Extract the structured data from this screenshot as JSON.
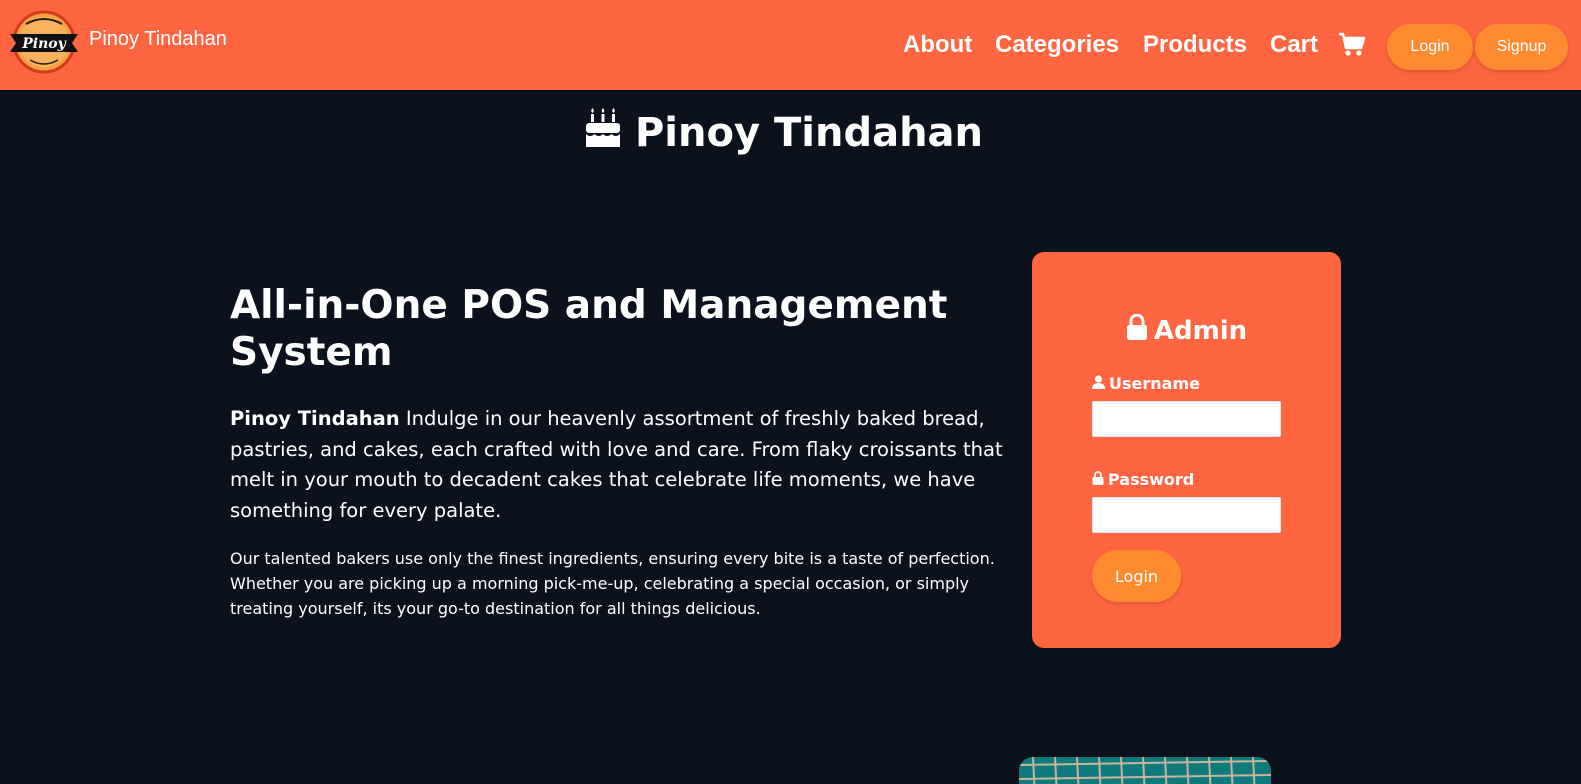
{
  "navbar": {
    "brand_name": "Pinoy Tindahan",
    "logo_text": "Pinoy",
    "links": [
      "About",
      "Categories",
      "Products",
      "Cart"
    ],
    "cart_icon": "shopping-cart-icon",
    "login_label": "Login",
    "signup_label": "Signup"
  },
  "page": {
    "title": "Pinoy Tindahan",
    "title_icon": "birthday-cake-icon"
  },
  "hero": {
    "heading": "All-in-One POS and Management System",
    "intro_bold": "Pinoy Tindahan",
    "intro_text": " Indulge in our heavenly assortment of freshly baked bread, pastries, and cakes, each crafted with love and care. From flaky croissants that melt in your mouth to decadent cakes that celebrate life moments, we have something for every palate.",
    "body": "Our talented bakers use only the finest ingredients, ensuring every bite is a taste of perfection. Whether you are picking up a morning pick-me-up, celebrating a special occasion, or simply treating yourself, its your go-to destination for all things delicious."
  },
  "admin": {
    "title": "Admin",
    "title_icon": "lock-icon",
    "username_label": "Username",
    "username_value": "",
    "password_label": "Password",
    "password_value": "",
    "login_label": "Login"
  },
  "colors": {
    "navbar": "#ff6540",
    "button": "#ff8a30",
    "background": "#0b111d",
    "card": "#ff6540"
  }
}
